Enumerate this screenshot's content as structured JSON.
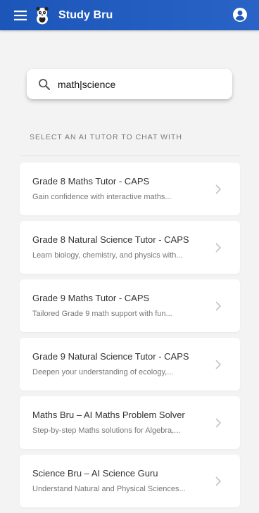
{
  "appbar": {
    "title": "Study Bru",
    "menu_icon": "hamburger-menu-icon",
    "logo_icon": "panda-mascot-logo",
    "account_icon": "account-circle-icon"
  },
  "search": {
    "value": "math|science",
    "icon": "search-icon"
  },
  "section": {
    "label": "SELECT AN AI TUTOR TO CHAT WITH"
  },
  "tutors": [
    {
      "title": "Grade 8 Maths Tutor - CAPS",
      "description": "Gain confidence with interactive maths..."
    },
    {
      "title": "Grade 8 Natural Science Tutor - CAPS",
      "description": "Learn biology, chemistry, and physics with..."
    },
    {
      "title": "Grade 9 Maths Tutor - CAPS",
      "description": "Tailored Grade 9 math support with fun..."
    },
    {
      "title": "Grade 9 Natural Science Tutor - CAPS",
      "description": "Deepen your understanding of ecology,..."
    },
    {
      "title": "Maths Bru – AI Maths Problem Solver",
      "description": "Step-by-step Maths solutions for Algebra,..."
    },
    {
      "title": "Science Bru – AI Science Guru",
      "description": "Understand Natural and Physical Sciences..."
    }
  ],
  "colors": {
    "appbar": "#1c56b8",
    "background": "#f3f3f3",
    "card": "#ffffff"
  }
}
